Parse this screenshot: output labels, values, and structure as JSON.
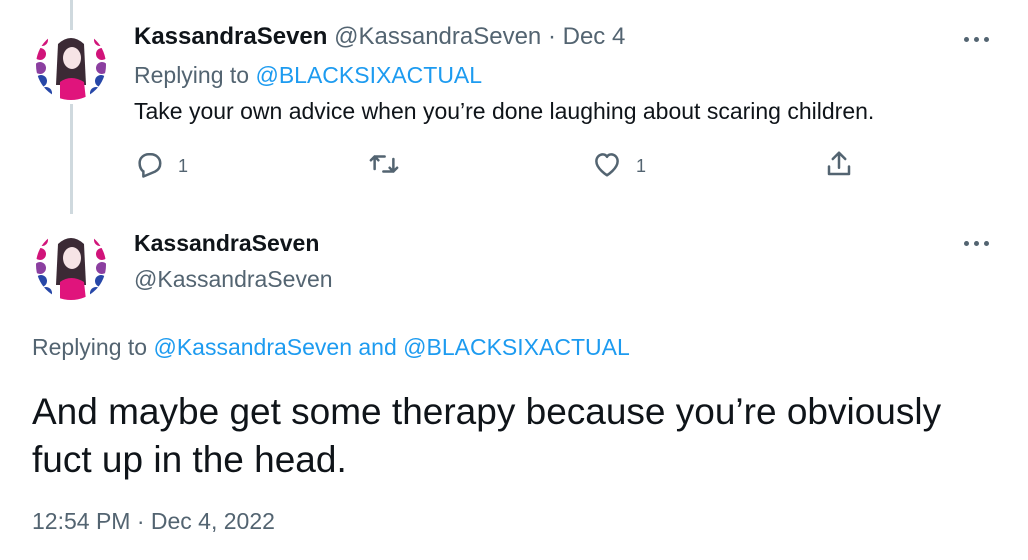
{
  "tweet1": {
    "display_name": "KassandraSeven",
    "handle": "@KassandraSeven",
    "separator": " · ",
    "date": "Dec 4",
    "replying_prefix": "Replying to ",
    "replying_to": "@BLACKSIXACTUAL",
    "text": "Take your own advice when you’re done laughing about scaring children.",
    "actions": {
      "reply_count": "1",
      "like_count": "1"
    }
  },
  "tweet2": {
    "display_name": "KassandraSeven",
    "handle": "@KassandraSeven",
    "replying_prefix": "Replying to ",
    "replying_to_1": "@KassandraSeven",
    "replying_and": " and ",
    "replying_to_2": "@BLACKSIXACTUAL",
    "text": "And maybe get some therapy because you’re obviously fuct up in the head.",
    "timestamp": "12:54 PM · Dec 4, 2022"
  },
  "icons": {
    "more": "more-horizontal-icon",
    "reply": "reply-icon",
    "retweet": "retweet-icon",
    "like": "like-icon",
    "share": "share-icon"
  },
  "colors": {
    "link": "#1d9bf0",
    "text": "#0f1419",
    "muted": "#536471",
    "thread_line": "#cfd9de"
  }
}
